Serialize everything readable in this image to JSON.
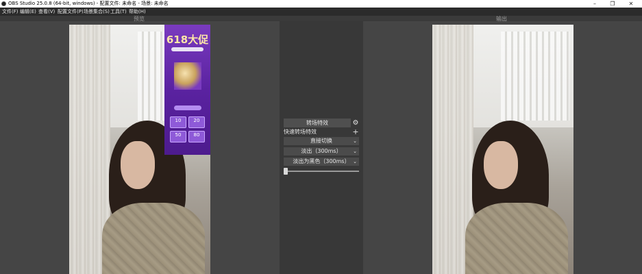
{
  "window": {
    "title": "OBS Studio 25.0.8 (64-bit, windows) - 配置文件: 未命名 - 场景: 未命名",
    "minimize": "–",
    "maximize": "❐",
    "close": "✕"
  },
  "menu": {
    "items": [
      "文件(F)",
      "编辑(E)",
      "查看(V)",
      "配置文件(P)",
      "场景集合(S)",
      "工具(T)",
      "帮助(H)"
    ]
  },
  "preview": {
    "label": "预览"
  },
  "program": {
    "label": "输出"
  },
  "transitions": {
    "title": "转场特效",
    "quick_label": "快速转场特效",
    "rows": [
      {
        "label": "直接切换"
      },
      {
        "label": "淡出（300ms）"
      },
      {
        "label": "淡出为黑色（300ms）"
      }
    ],
    "slider_level": 0
  },
  "ad": {
    "headline": "618大促",
    "coupons": [
      "10",
      "20",
      "50",
      "80"
    ]
  },
  "colors": {
    "background": "#3a3a3a",
    "menubar": "#2b2b2b",
    "ad_purple": "#5a22a0"
  }
}
